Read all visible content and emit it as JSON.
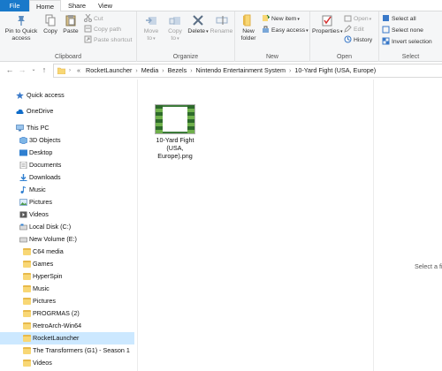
{
  "tabs": {
    "file": "File",
    "home": "Home",
    "share": "Share",
    "view": "View"
  },
  "ribbon": {
    "clipboard": {
      "label": "Clipboard",
      "pin": "Pin to Quick access",
      "copy": "Copy",
      "paste": "Paste",
      "cut": "Cut",
      "copy_path": "Copy path",
      "paste_shortcut": "Paste shortcut"
    },
    "organize": {
      "label": "Organize",
      "move_to": "Move to",
      "copy_to": "Copy to",
      "delete": "Delete",
      "rename": "Rename"
    },
    "new": {
      "label": "New",
      "new_folder": "New folder",
      "new_item": "New item",
      "easy_access": "Easy access"
    },
    "open": {
      "label": "Open",
      "properties": "Properties",
      "open": "Open",
      "edit": "Edit",
      "history": "History"
    },
    "select": {
      "label": "Select",
      "select_all": "Select all",
      "select_none": "Select none",
      "invert": "Invert selection"
    }
  },
  "address": {
    "overflow": "«",
    "crumbs": [
      "RocketLauncher",
      "Media",
      "Bezels",
      "Nintendo Entertainment System",
      "10-Yard Fight (USA, Europe)"
    ]
  },
  "nav": {
    "quick_access": "Quick access",
    "onedrive": "OneDrive",
    "this_pc": "This PC",
    "objects3d": "3D Objects",
    "desktop": "Desktop",
    "documents": "Documents",
    "downloads": "Downloads",
    "music": "Music",
    "pictures": "Pictures",
    "videos": "Videos",
    "local_disk": "Local Disk (C:)",
    "new_volume": "New Volume (E:)",
    "folders": [
      "C64 media",
      "Games",
      "HyperSpin",
      "Music",
      "Pictures",
      "PROGRMAS (2)",
      "RetroArch-Win64",
      "RocketLauncher",
      "The Transformers (G1) - Season 1",
      "Videos"
    ]
  },
  "file": {
    "name": "10-Yard Fight (USA, Europe).png"
  },
  "preview": {
    "text": "Select a file"
  },
  "colors": {
    "accent": "#1979ca",
    "selected": "#cce8ff",
    "folder": "#f8d775"
  }
}
